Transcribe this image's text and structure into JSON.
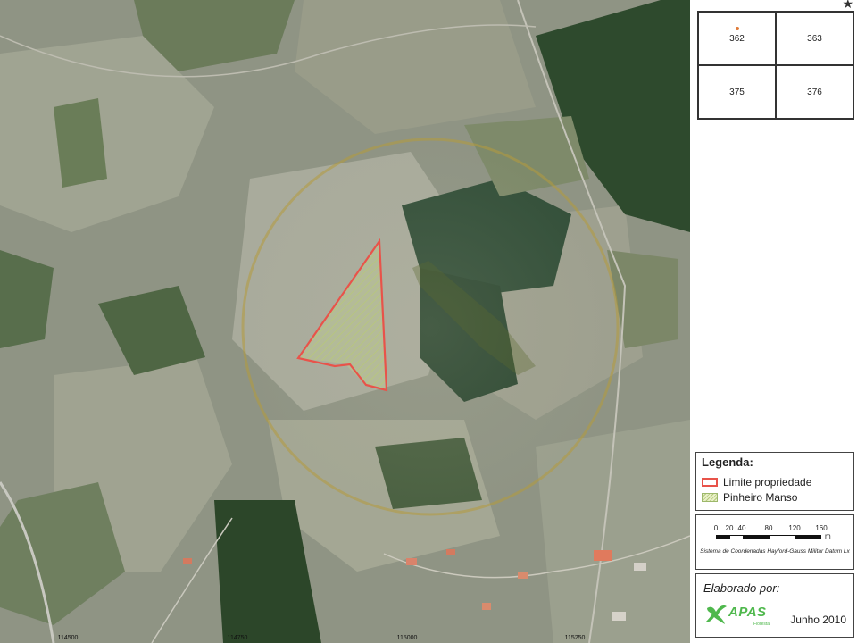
{
  "map": {
    "bottom_coordinates": [
      "114500",
      "114750",
      "115000",
      "115250"
    ]
  },
  "index_grid": {
    "cells": [
      "362",
      "363",
      "375",
      "376"
    ],
    "highlighted_cell": "362"
  },
  "legend": {
    "title": "Legenda:",
    "items": [
      {
        "label": "Limite propriedade",
        "color": "#e8534a",
        "icon": "red-outline-swatch"
      },
      {
        "label": "Pinheiro Manso",
        "color": "#b3c97a",
        "icon": "hatched-green-swatch"
      }
    ]
  },
  "scale": {
    "labels": [
      "0",
      "20",
      "40",
      "80",
      "120",
      "160"
    ],
    "unit": "m",
    "note": "Sistema de Coordenadas Hayford-Gauss Militar Datum Lx"
  },
  "credits": {
    "label": "Elaborado por:",
    "logo_text": "APAS",
    "logo_sub": "Floresta",
    "date": "Junho 2010"
  },
  "colors": {
    "property_boundary": "#e8534a",
    "buffer_ring": "#b59a3c",
    "vegetation_dark": "#2f4a2c",
    "field_light": "#a8a99a"
  }
}
